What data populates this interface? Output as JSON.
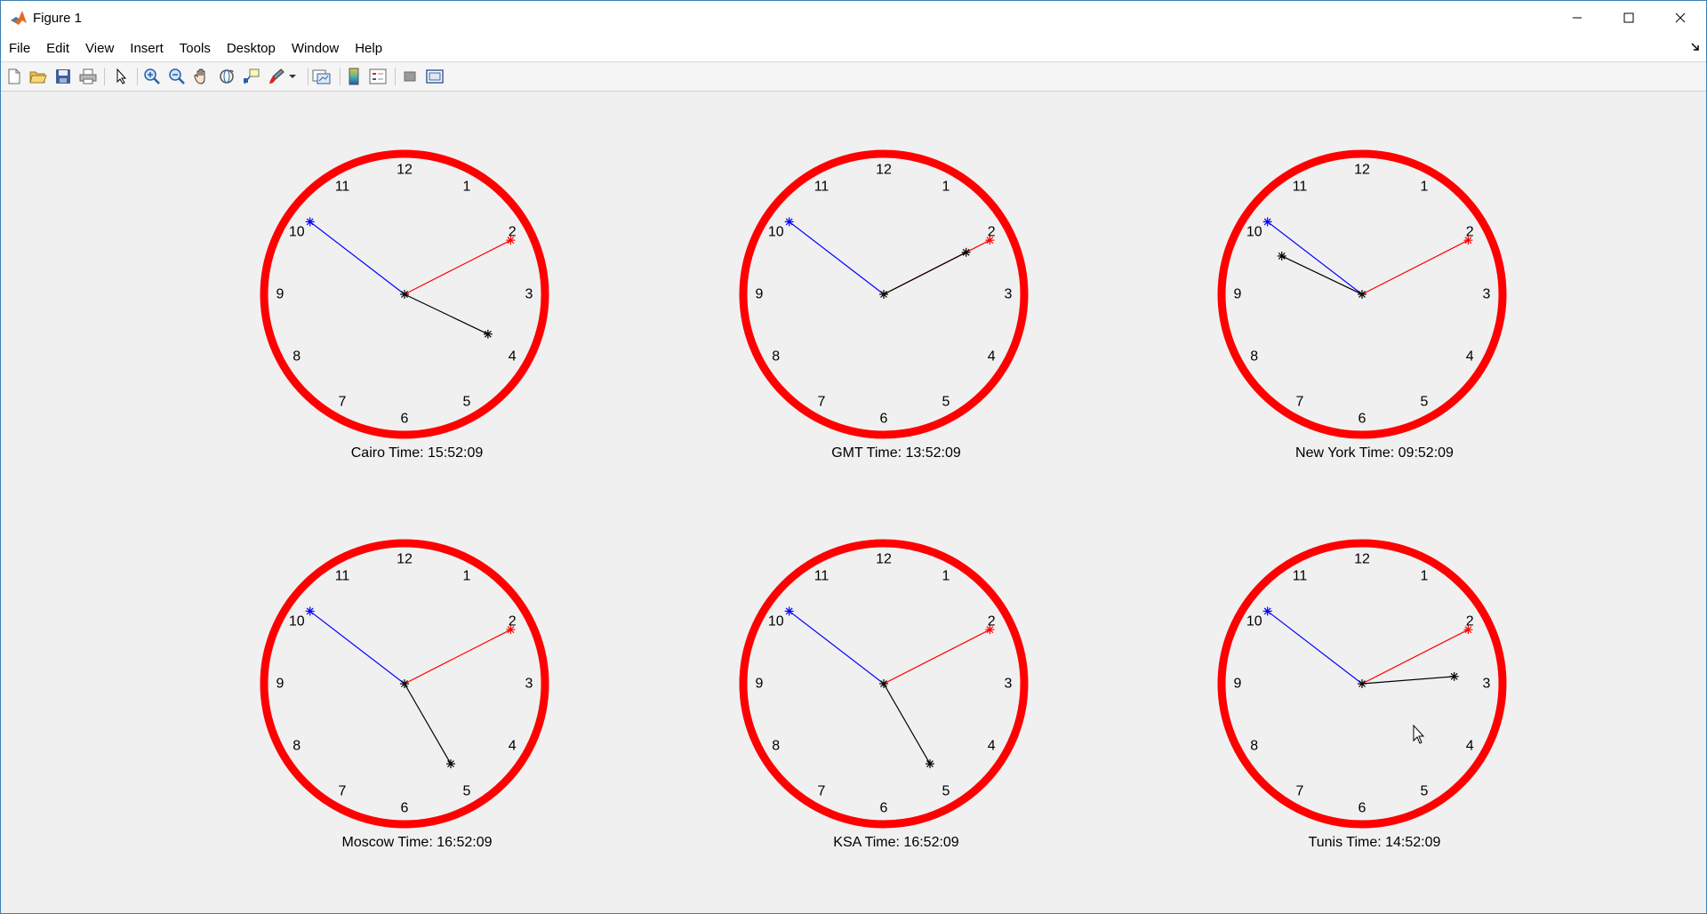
{
  "window": {
    "title": "Figure 1",
    "controls": [
      "minimize-icon",
      "maximize-icon",
      "close-icon"
    ]
  },
  "menubar": {
    "items": [
      "File",
      "Edit",
      "View",
      "Insert",
      "Tools",
      "Desktop",
      "Window",
      "Help"
    ]
  },
  "toolbar": {
    "buttons": [
      "new-figure-icon",
      "open-file-icon",
      "save-figure-icon",
      "print-figure-icon",
      "edit-plot-arrow-icon",
      "zoom-in-icon",
      "zoom-out-icon",
      "pan-hand-icon",
      "rotate-3d-icon",
      "data-cursor-icon",
      "brush-icon",
      "link-plot-icon",
      "insert-colorbar-icon",
      "insert-legend-icon",
      "hide-plot-tools-icon",
      "show-plot-tools-icon"
    ]
  },
  "colors": {
    "dial": "#ff0000",
    "hour_hand": "#0000ff",
    "minute_hand": "#ff0000",
    "second_hand": "#000000"
  },
  "dial_numbers": [
    "12",
    "1",
    "2",
    "3",
    "4",
    "5",
    "6",
    "7",
    "8",
    "9",
    "10",
    "11"
  ],
  "clocks": [
    {
      "label": "Cairo Time: 15:52:09",
      "hour_dir": 10.25,
      "minute_dir": 2.1,
      "second_dir": 3.85
    },
    {
      "label": "GMT Time: 13:52:09",
      "hour_dir": 10.25,
      "minute_dir": 2.1,
      "second_dir": 2.1
    },
    {
      "label": "New York Time: 09:52:09",
      "hour_dir": 10.25,
      "minute_dir": 2.1,
      "second_dir": 9.85
    },
    {
      "label": "Moscow Time: 16:52:09",
      "hour_dir": 10.25,
      "minute_dir": 2.1,
      "second_dir": 5.0
    },
    {
      "label": "KSA Time: 16:52:09",
      "hour_dir": 10.25,
      "minute_dir": 2.1,
      "second_dir": 5.0
    },
    {
      "label": "Tunis Time: 14:52:09",
      "hour_dir": 10.25,
      "minute_dir": 2.1,
      "second_dir": 2.85
    }
  ]
}
